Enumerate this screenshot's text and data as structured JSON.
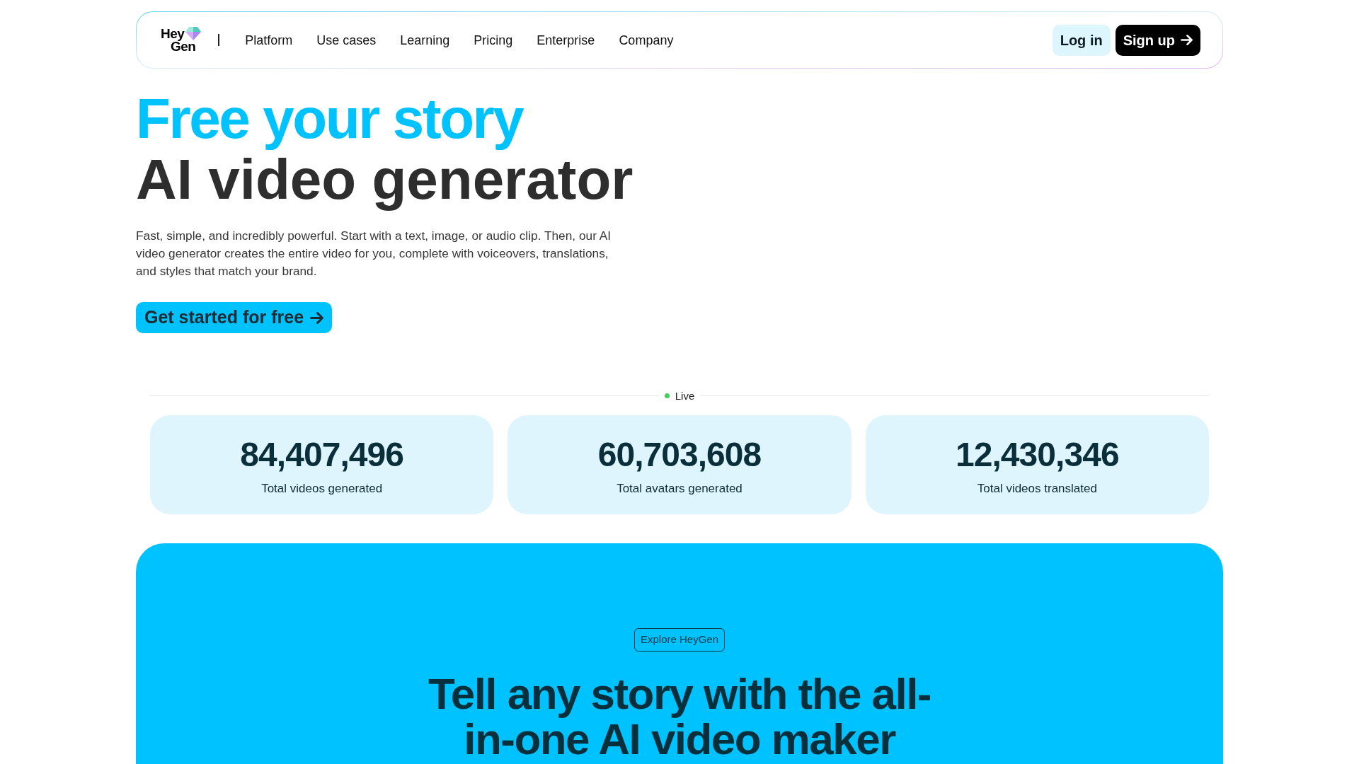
{
  "nav": {
    "logo": {
      "lines": [
        "Hey",
        "Gen"
      ]
    },
    "links": [
      "Platform",
      "Use cases",
      "Learning",
      "Pricing",
      "Enterprise",
      "Company"
    ],
    "buttons": [
      {
        "kind": "secondary",
        "label": "Log in"
      },
      {
        "kind": "primary",
        "label": "Sign up"
      }
    ]
  },
  "hero": {
    "title_accent": "Free your story",
    "title": "AI video generator",
    "description": "Fast, simple, and incredibly powerful. Start with a text, image, or audio clip. Then, our AI video generator creates the entire video for you, complete with voiceovers, translations, and styles that match your brand.",
    "cta": {
      "label": "Get started for free"
    }
  },
  "stats": {
    "live": {
      "label": "Live",
      "active": true
    },
    "items": [
      {
        "value": "84,407,496",
        "label": "Total videos generated"
      },
      {
        "value": "60,703,608",
        "label": "Total avatars generated"
      },
      {
        "value": "12,430,346",
        "label": "Total videos translated"
      }
    ]
  },
  "explore": {
    "badge": "Explore HeyGen",
    "heading": "Tell any story with the all-in-one AI video maker"
  }
}
